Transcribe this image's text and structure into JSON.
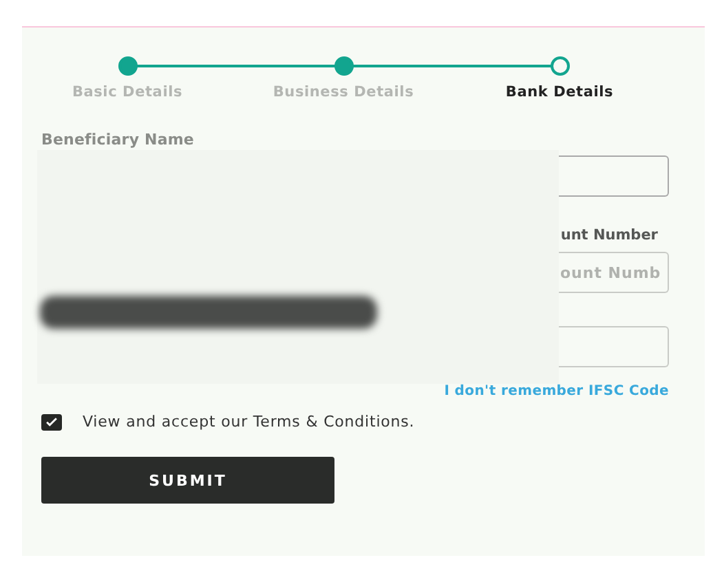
{
  "steps": [
    {
      "label": "Basic Details",
      "done": true,
      "selected": false
    },
    {
      "label": "Business Details",
      "done": true,
      "selected": false
    },
    {
      "label": "Bank Details",
      "done": false,
      "selected": true
    }
  ],
  "fields": [
    {
      "label": "Beneficiary Name"
    },
    {
      "label": "unt Number",
      "placeholder": "ount Numb"
    }
  ],
  "link": "I don't remember IFSC Code",
  "terms": {
    "label": "View and accept our Terms & Conditions.",
    "checked": true
  },
  "submit": "SUBMIT"
}
